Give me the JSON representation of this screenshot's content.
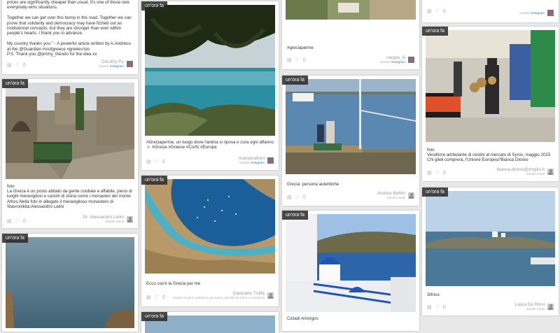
{
  "badge_label": "un'ora fa",
  "cards": {
    "c1": {
      "text": "prices are significantly cheaper than usual. It's one of those rare everybody-wins situations.\n\nTogether we can get over this bump in the road. Together we can prove that solidarity and democracy may have fizzled out as institutional concepts, but they are stronger than ever within people's hearts. I thank you in advance.\n\nMy country thanks you.\" - A powerful article written by A.Andreou at the @Guardian #visitgreece #greekcrisis\nP.S. Thank you @jimmy_theodo for the idea xx",
      "likes": "0",
      "author": "Dorothy Pu",
      "via": "tramite",
      "source": "Instagram"
    },
    "c2": {
      "label": "foto",
      "text": "La Grecia è un posto abitato da gente cordiale e affabile, pieno di luoghi meravigliosi e carichi di storia come i monasteri del monte Athos.Nella foto in allegato il meraviglioso monastero di Stavronikita.Alessandro Latini",
      "likes": "0",
      "author": "Dr. Alessandro Latini",
      "via": "tramite email"
    },
    "c4": {
      "text": "#Greciaperme, un luogo dove l'anima si riposa e cura ogni affanno ☺ #Grecia #Greece #Corfù #Europa",
      "likes": "0",
      "author": "mariparafioni",
      "via": "tramite",
      "source": "Instagram"
    },
    "c5": {
      "text": "Ecco cos'è la Grecia per me",
      "likes": "0",
      "author": "Giancarlo Truffa",
      "via": "tramite email il contributo da buona volontà dei primi 4 commenti"
    },
    "c7": {
      "text": "#greciaperme",
      "likes": "0",
      "author": "vargas_iii",
      "via": "tramite",
      "source": "Instagram"
    },
    "c8": {
      "text": "Grecia: persone autentiche",
      "likes": "0",
      "author": "Andrea Bettini",
      "via": "tramite email"
    },
    "c9": {
      "text": "Cicladi Amorgos"
    },
    "c10": {
      "likes": "0",
      "via": "tramite",
      "source": "Instagram"
    },
    "c11": {
      "label": "foto",
      "text": "Venditore ambulante di cestini al mercato di Syros, maggio 2015 Chi glieli comprerà, l'Unione Europea?Bianca Dionisi",
      "likes": "0",
      "author": "bianca.dionisi@virgilio.it",
      "via": "tramite email"
    },
    "c12": {
      "label": "Sifnos",
      "likes": "0",
      "author": "Laura De Rinvi",
      "via": "tramite email"
    }
  },
  "icons": [
    "share-icon",
    "heart-icon",
    "person-avatar-icon",
    "instagram-icon"
  ]
}
